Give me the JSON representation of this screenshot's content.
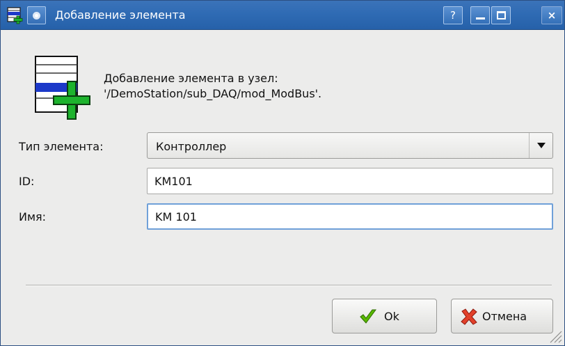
{
  "window": {
    "title": "Добавление элемента",
    "help_label": "?",
    "close_label": "×"
  },
  "header": {
    "line1": "Добавление элемента в узел:",
    "line2": "'/DemoStation/sub_DAQ/mod_ModBus'."
  },
  "form": {
    "type_label": "Тип элемента:",
    "type_value": "Контроллер",
    "id_label": "ID:",
    "id_value": "KM101",
    "name_label": "Имя:",
    "name_value": "KM 101"
  },
  "buttons": {
    "ok_label": "Ok",
    "cancel_label": "Отмена"
  },
  "icons": {
    "app": "add-element-icon",
    "menu": "window-menu-icon",
    "ok": "check-icon",
    "cancel": "cross-icon",
    "dropdown": "chevron-down-icon",
    "grip": "resize-grip-icon"
  },
  "colors": {
    "titlebar": "#2f6bb4",
    "accent_blue": "#1c39c9",
    "plus_green": "#1db32d",
    "ok_green": "#58b800",
    "cancel_red": "#e2402a"
  }
}
